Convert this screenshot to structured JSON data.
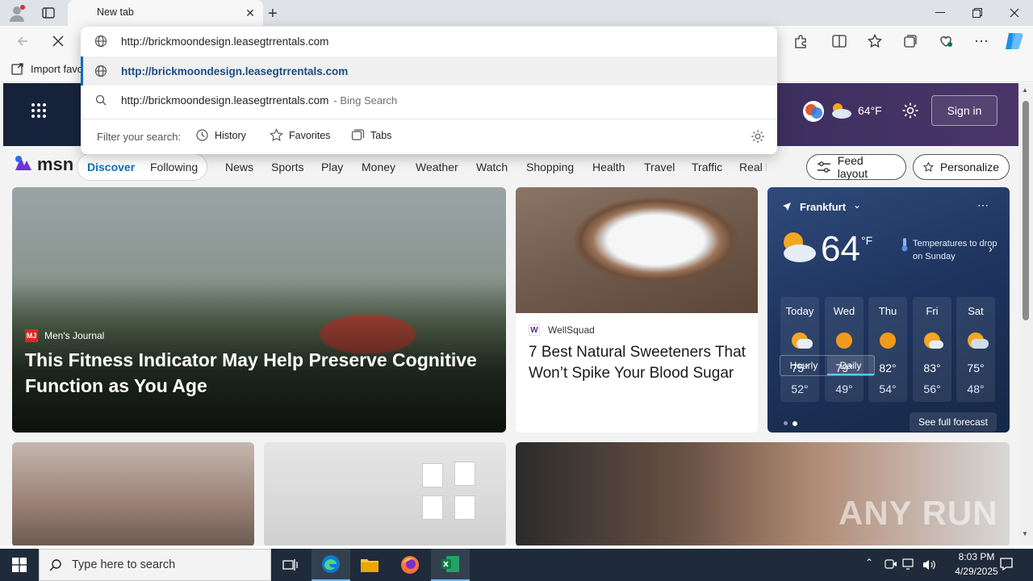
{
  "browser": {
    "tab_title": "New tab",
    "url": "http://brickmoondesign.leasegtrrentals.com",
    "favorites_label": "Import favo"
  },
  "dropdown": {
    "url_suggestion": "http://brickmoondesign.leasegtrrentals.com",
    "search_text": "http://brickmoondesign.leasegtrrentals.com",
    "search_suffix": "- Bing Search",
    "filter_label": "Filter your search:",
    "filters": [
      "History",
      "Favorites",
      "Tabs"
    ]
  },
  "header": {
    "weather_temp": "64°F",
    "sign_in": "Sign in"
  },
  "msn": {
    "logo": "msn",
    "tabs": [
      "Discover",
      "Following"
    ],
    "nav": [
      "News",
      "Sports",
      "Play",
      "Money",
      "Weather",
      "Watch",
      "Shopping",
      "Health",
      "Travel",
      "Traffic",
      "Real E"
    ],
    "feed_layout": "Feed layout",
    "personalize": "Personalize"
  },
  "card1": {
    "source": "Men's Journal",
    "source_logo": "MJ",
    "headline": "This Fitness Indicator May Help Preserve Cognitive Function as You Age"
  },
  "card2": {
    "source": "WellSquad",
    "source_logo": "W",
    "headline": "7 Best Natural Sweeteners That Won’t Spike Your Blood Sugar"
  },
  "weather": {
    "location": "Frankfurt",
    "temp": "64",
    "unit": "°F",
    "alert": "Temperatures to drop on Sunday",
    "toggle": [
      "Hourly",
      "Daily"
    ],
    "days": [
      {
        "day": "Today",
        "hi": "75°",
        "lo": "52°"
      },
      {
        "day": "Wed",
        "hi": "79°",
        "lo": "49°"
      },
      {
        "day": "Thu",
        "hi": "82°",
        "lo": "54°"
      },
      {
        "day": "Fri",
        "hi": "83°",
        "lo": "56°"
      },
      {
        "day": "Sat",
        "hi": "75°",
        "lo": "48°"
      }
    ],
    "see_full": "See full forecast"
  },
  "taskbar": {
    "search_placeholder": "Type here to search",
    "time": "8:03 PM",
    "date": "4/29/2025"
  },
  "watermark": "ANY RUN",
  "colors": {
    "accent": "#0f6cbd",
    "taskbar": "#1f2b3a",
    "weather_bg": "#1f3560"
  }
}
